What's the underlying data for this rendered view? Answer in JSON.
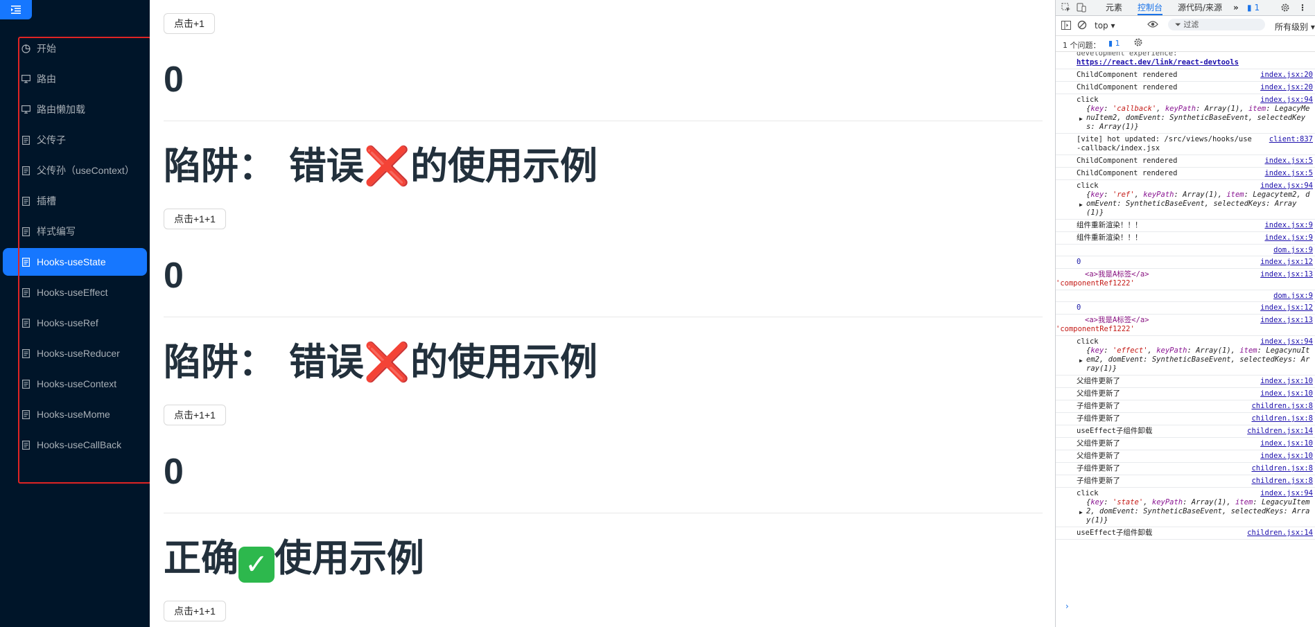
{
  "sidebar": {
    "items": [
      {
        "label": "开始",
        "icon": "pie-chart-icon"
      },
      {
        "label": "路由",
        "icon": "desktop-icon"
      },
      {
        "label": "路由懒加载",
        "icon": "desktop-icon"
      },
      {
        "label": "父传子",
        "icon": "file-icon"
      },
      {
        "label": "父传孙（useContext）",
        "icon": "file-icon"
      },
      {
        "label": "插槽",
        "icon": "file-icon"
      },
      {
        "label": "样式编写",
        "icon": "file-icon"
      },
      {
        "label": "Hooks-useState",
        "icon": "file-icon",
        "active": true
      },
      {
        "label": "Hooks-useEffect",
        "icon": "file-icon"
      },
      {
        "label": "Hooks-useRef",
        "icon": "file-icon"
      },
      {
        "label": "Hooks-useReducer",
        "icon": "file-icon"
      },
      {
        "label": "Hooks-useContext",
        "icon": "file-icon"
      },
      {
        "label": "Hooks-useMome",
        "icon": "file-icon"
      },
      {
        "label": "Hooks-useCallBack",
        "icon": "file-icon"
      }
    ]
  },
  "main": {
    "btn1": "点击+1",
    "count1": "0",
    "heading1_a": "陷阱：",
    "heading1_b": "错误",
    "heading1_x": "❌",
    "heading1_c": "的使用示例",
    "btn2": "点击+1+1",
    "count2": "0",
    "heading2_a": "陷阱：",
    "heading2_b": "错误",
    "heading2_x": "❌",
    "heading2_c": "的使用示例",
    "btn3": "点击+1+1",
    "count3": "0",
    "heading3_a": "正确",
    "heading3_check": "✓",
    "heading3_c": "使用示例",
    "btn4": "点击+1+1"
  },
  "devtools": {
    "tabs": [
      "元素",
      "控制台",
      "源代码/来源"
    ],
    "active_tab": "控制台",
    "issues_badge": "1",
    "context": "top",
    "filter_placeholder": "过滤",
    "levels": "所有级别",
    "issues_label": "1 个问题：",
    "issues_count": "1",
    "top_clip": "development experience:",
    "top_link": "https://react.dev/link/react-devtools",
    "accent": "#1a73e8"
  },
  "console": [
    {
      "msg": "ChildComponent rendered",
      "src": "index.jsx:20"
    },
    {
      "msg": "ChildComponent rendered",
      "src": "index.jsx:20"
    },
    {
      "msg": "click",
      "src": "index.jsx:94",
      "obj_key": "callback",
      "obj_rest": "MenuItem2, domEvent: SyntheticBaseEvent, selectedKeys: Array(1)}"
    },
    {
      "msg": "[vite] hot updated: /src/views/hooks/use-callback/index.jsx",
      "src": "client:837"
    },
    {
      "msg": "ChildComponent rendered",
      "src": "index.jsx:5"
    },
    {
      "msg": "ChildComponent rendered",
      "src": "index.jsx:5"
    },
    {
      "msg": "click",
      "src": "index.jsx:94",
      "obj_key": "ref",
      "obj_rest": "tem2, domEvent: SyntheticBaseEvent, selectedKeys: Array(1)}"
    },
    {
      "msg": "组件重新渲染！！！",
      "src": "index.jsx:9"
    },
    {
      "msg": "组件重新渲染！！！",
      "src": "index.jsx:9"
    },
    {
      "msg": "",
      "src": "dom.jsx:9"
    },
    {
      "msg": "0",
      "src": "index.jsx:12",
      "num": true
    },
    {
      "msg": "<a>我是A标签</a>",
      "src": "index.jsx:13",
      "str": "'componentRef1222'"
    },
    {
      "msg": "",
      "src": "dom.jsx:9"
    },
    {
      "msg": "0",
      "src": "index.jsx:12",
      "num": true
    },
    {
      "msg": "<a>我是A标签</a>",
      "src": "index.jsx:13",
      "str": "'componentRef1222'"
    },
    {
      "msg": "click",
      "src": "index.jsx:94",
      "obj_key": "effect",
      "obj_rest": "nuItem2, domEvent: SyntheticBaseEvent, selectedKeys: Array(1)}"
    },
    {
      "msg": "父组件更新了",
      "src": "index.jsx:10"
    },
    {
      "msg": "父组件更新了",
      "src": "index.jsx:10"
    },
    {
      "msg": "子组件更新了",
      "src": "children.jsx:8"
    },
    {
      "msg": "子组件更新了",
      "src": "children.jsx:8"
    },
    {
      "msg": "useEffect子组件卸载",
      "src": "children.jsx:14"
    },
    {
      "msg": "父组件更新了",
      "src": "index.jsx:10"
    },
    {
      "msg": "父组件更新了",
      "src": "index.jsx:10"
    },
    {
      "msg": "子组件更新了",
      "src": "children.jsx:8"
    },
    {
      "msg": "子组件更新了",
      "src": "children.jsx:8"
    },
    {
      "msg": "click",
      "src": "index.jsx:94",
      "obj_key": "state",
      "obj_rest": "uItem2, domEvent: SyntheticBaseEvent, selectedKeys: Array(1)}"
    },
    {
      "msg": "useEffect子组件卸载",
      "src": "children.jsx:14"
    }
  ]
}
